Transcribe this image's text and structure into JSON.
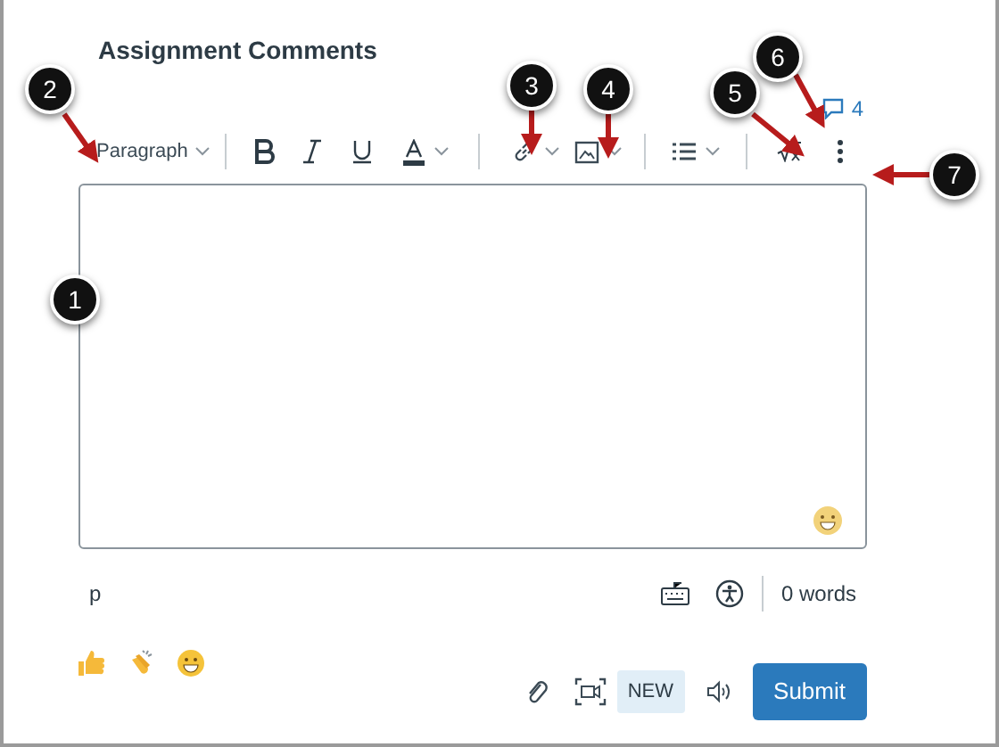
{
  "title": "Assignment Comments",
  "comment_count": "4",
  "toolbar": {
    "block_format": "Paragraph"
  },
  "status_bar": {
    "element_path": "p",
    "word_count": "0 words"
  },
  "footer": {
    "new_badge": "NEW",
    "submit": "Submit"
  },
  "callouts": [
    "1",
    "2",
    "3",
    "4",
    "5",
    "6",
    "7"
  ]
}
